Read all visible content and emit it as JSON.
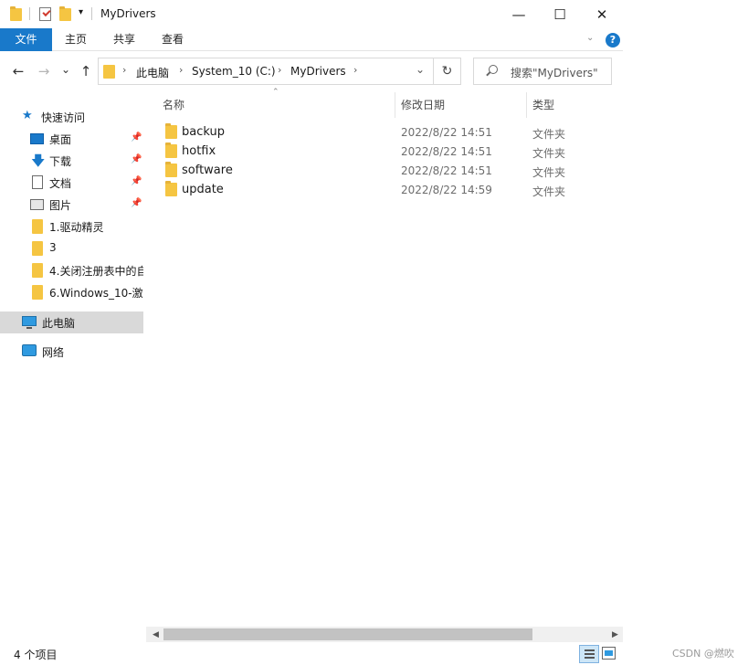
{
  "window": {
    "title": "MyDrivers",
    "minimize": "—",
    "maximize": "☐",
    "close": "✕"
  },
  "ribbon": {
    "tabs": [
      {
        "label": "文件"
      },
      {
        "label": "主页"
      },
      {
        "label": "共享"
      },
      {
        "label": "查看"
      }
    ],
    "expand_icon": "chevron-down-icon",
    "help": "?"
  },
  "navigation": {
    "back": "←",
    "forward": "→",
    "recent": "⌄",
    "up": "↑",
    "breadcrumb": [
      "此电脑",
      "System_10 (C:)",
      "MyDrivers"
    ],
    "refresh": "↻",
    "search_placeholder": "搜索\"MyDrivers\""
  },
  "sidebar": {
    "quick_access": "快速访问",
    "pinned": [
      {
        "label": "桌面",
        "icon": "desktop-icon"
      },
      {
        "label": "下载",
        "icon": "download-icon"
      },
      {
        "label": "文档",
        "icon": "document-icon"
      },
      {
        "label": "图片",
        "icon": "pictures-icon"
      }
    ],
    "folders": [
      {
        "label": "1.驱动精灵"
      },
      {
        "label": "3"
      },
      {
        "label": "4.关闭注册表中的自"
      },
      {
        "label": "6.Windows_10-激"
      }
    ],
    "this_pc": "此电脑",
    "network": "网络"
  },
  "columns": {
    "name": "名称",
    "date": "修改日期",
    "type": "类型"
  },
  "files": [
    {
      "name": "backup",
      "date": "2022/8/22 14:51",
      "type": "文件夹"
    },
    {
      "name": "hotfix",
      "date": "2022/8/22 14:51",
      "type": "文件夹"
    },
    {
      "name": "software",
      "date": "2022/8/22 14:51",
      "type": "文件夹"
    },
    {
      "name": "update",
      "date": "2022/8/22 14:59",
      "type": "文件夹"
    }
  ],
  "status": {
    "count": "4 个项目"
  },
  "watermark": "CSDN @燃吹",
  "colors": {
    "accent": "#1979ca",
    "folder": "#f5c542",
    "selected": "#d9d9d9"
  }
}
